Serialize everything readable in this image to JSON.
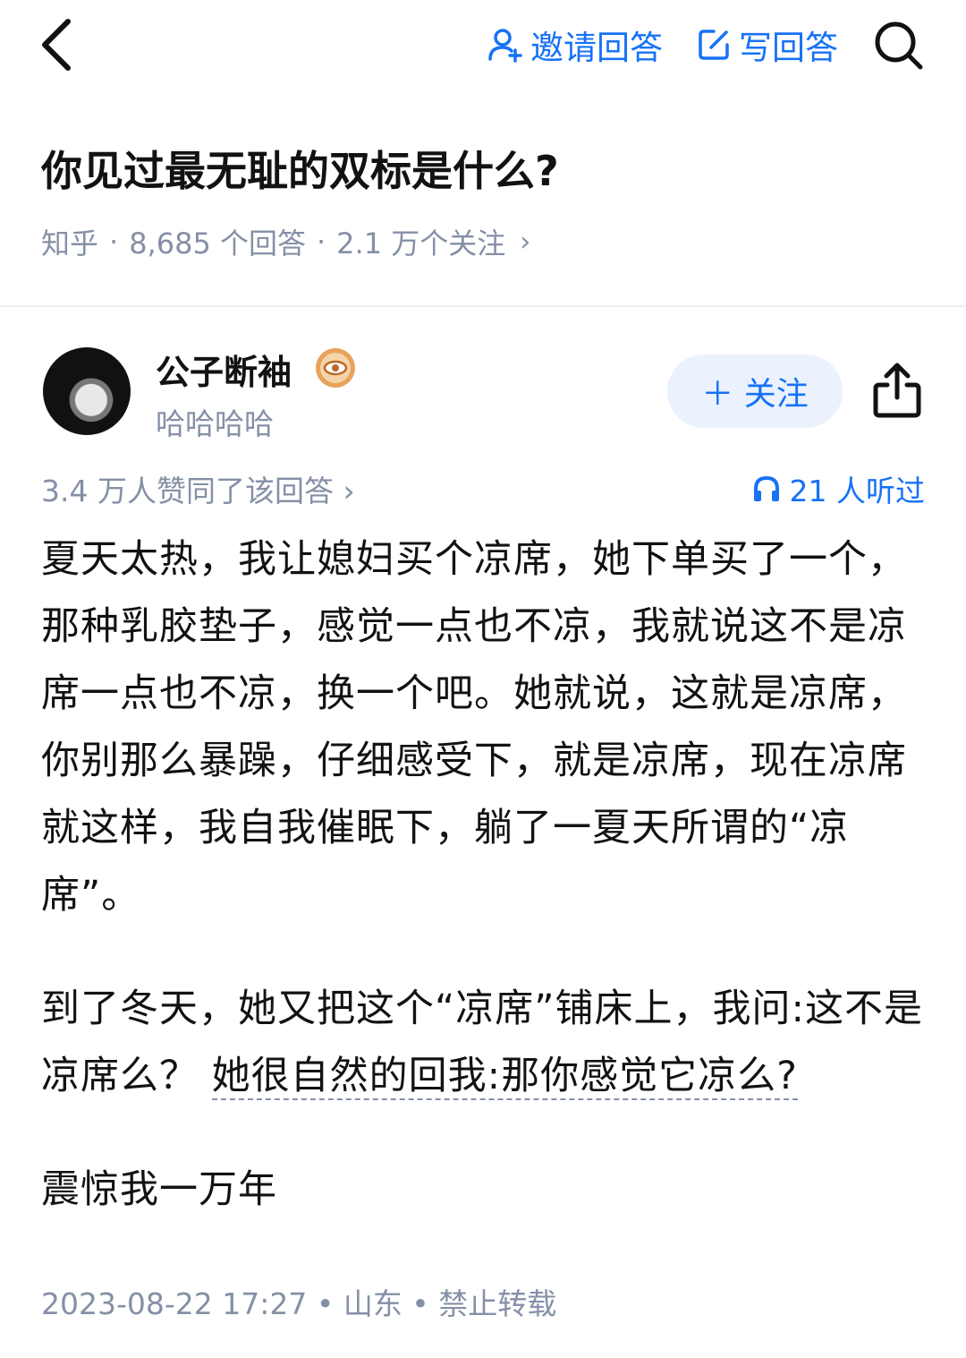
{
  "header": {
    "invite_label": "邀请回答",
    "write_label": "写回答",
    "icons": [
      "back-icon",
      "invite-user-icon",
      "edit-icon",
      "search-icon"
    ]
  },
  "question": {
    "title": "你见过最无耻的双标是什么?",
    "source": "知乎",
    "answers": "8,685 个回答",
    "followers": "2.1 万个关注",
    "chevron": "›"
  },
  "author": {
    "name": "公子断袖",
    "bio": "哈哈哈哈",
    "follow_label": "＋ 关注"
  },
  "stats": {
    "votes": "3.4 万人赞同了该回答 ›",
    "listened": "21 人听过"
  },
  "answer": {
    "paragraph1": "夏天太热，我让媳妇买个凉席，她下单买了一个，那种乳胶垫子，感觉一点也不凉，我就说这不是凉席一点也不凉，换一个吧。她就说，这就是凉席，你别那么暴躁，仔细感受下，就是凉席，现在凉席就这样，我自我催眠下，躺了一夏天所谓的“凉席”。",
    "paragraph2_a": "到了冬天，她又把这个“凉席”铺床上，我问:这不是凉席么？ ",
    "paragraph2_b": "她很自然的回我:那你感觉它凉么?",
    "paragraph3": "震惊我一万年"
  },
  "footer": {
    "meta": "2023-08-22 17:27 • 山东 • 禁止转载"
  },
  "colors": {
    "accent": "#1772f6",
    "muted": "#8590a6",
    "text": "#121212",
    "follow_bg": "#ebf2fd"
  }
}
